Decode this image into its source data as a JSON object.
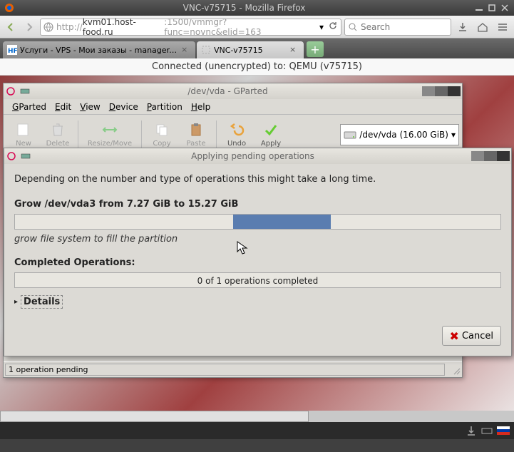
{
  "firefox": {
    "title": "VNC-v75715 - Mozilla Firefox",
    "url": {
      "protocol": "http://",
      "host": "kvm01.host-food.ru",
      "port_path": ":1500/vmmgr?func=novnc&elid=163"
    },
    "search_placeholder": "Search",
    "tabs": [
      {
        "label": "Услуги - VPS - Мои заказы - manager.h…",
        "favicon": "hf"
      },
      {
        "label": "VNC-v75715",
        "favicon": "blank"
      }
    ]
  },
  "vnc": {
    "status": "Connected (unencrypted) to: QEMU (v75715)"
  },
  "gparted": {
    "title": "/dev/vda - GParted",
    "menu": {
      "app": "GParted",
      "edit": "Edit",
      "view": "View",
      "device": "Device",
      "partition": "Partition",
      "help": "Help"
    },
    "toolbar": {
      "new": "New",
      "delete": "Delete",
      "resize": "Resize/Move",
      "copy": "Copy",
      "paste": "Paste",
      "undo": "Undo",
      "apply": "Apply"
    },
    "device": {
      "path": "/dev/vda",
      "size": "(16.00 GiB)"
    },
    "statusbar": "1 operation pending"
  },
  "dialog": {
    "title": "Applying pending operations",
    "intro": "Depending on the number and type of operations this might take a long time.",
    "operation_title": "Grow /dev/vda3 from 7.27 GiB to 15.27 GiB",
    "suboperation": "grow file system to fill the partition",
    "completed_title": "Completed Operations:",
    "completed_text": "0 of 1 operations completed",
    "details": "Details",
    "cancel": "Cancel"
  }
}
